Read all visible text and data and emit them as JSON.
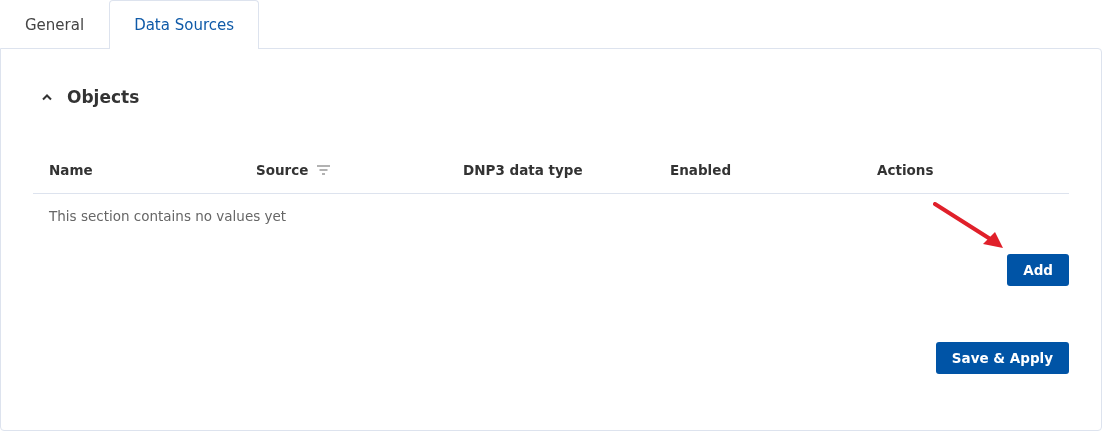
{
  "tabs": [
    {
      "label": "General",
      "selected": false
    },
    {
      "label": "Data Sources",
      "selected": true
    }
  ],
  "section": {
    "title": "Objects",
    "expanded": true,
    "table": {
      "columns": [
        {
          "label": "Name",
          "filter": false
        },
        {
          "label": "Source",
          "filter": true
        },
        {
          "label": "DNP3 data type",
          "filter": false
        },
        {
          "label": "Enabled",
          "filter": false
        },
        {
          "label": "Actions",
          "filter": false
        }
      ],
      "empty_message": "This section contains no values yet"
    },
    "add_button": "Add"
  },
  "save_button": "Save & Apply"
}
